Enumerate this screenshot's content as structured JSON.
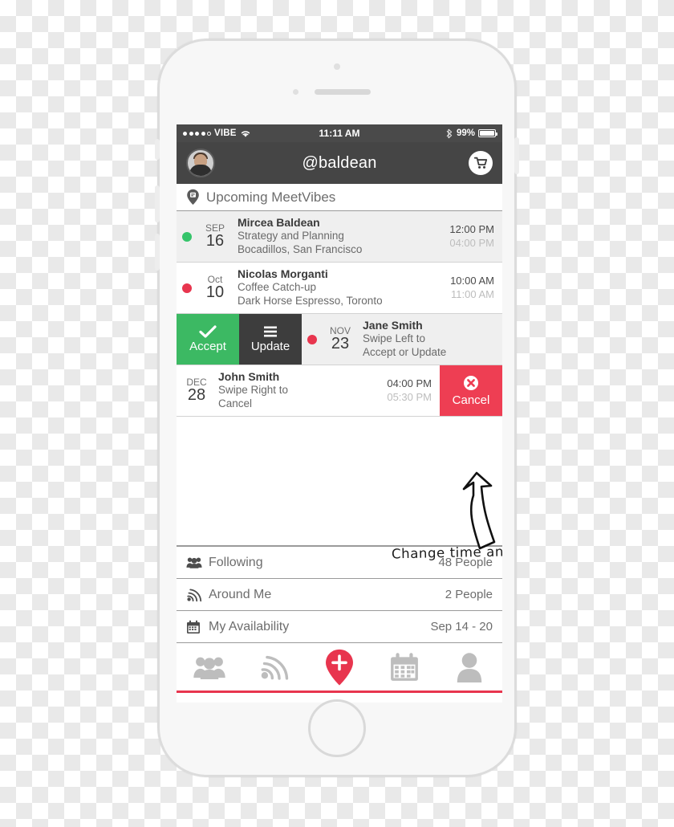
{
  "status_bar": {
    "signal_dots_filled": 4,
    "signal_dots_total": 5,
    "carrier": "VIBE",
    "wifi_icon": "wifi-icon",
    "time": "11:11 AM",
    "bluetooth_icon": "bluetooth-icon",
    "battery_pct": "99%",
    "battery_level": 99
  },
  "navbar": {
    "avatar_icon": "user-avatar",
    "title": "@baldean",
    "cart_icon": "shopping-cart-icon"
  },
  "section_header": {
    "pin_icon": "map-pin-icon",
    "label": "Upcoming MeetVibes"
  },
  "meetings": [
    {
      "dot_color": "#35c46a",
      "month": "SEP",
      "day": "16",
      "name": "Mircea Baldean",
      "subject": "Strategy and Planning",
      "location": "Bocadillos, San Francisco",
      "start": "12:00 PM",
      "end": "04:00 PM",
      "shaded": true
    },
    {
      "dot_color": "#e8354e",
      "month": "Oct",
      "day": "10",
      "name": "Nicolas Morganti",
      "subject": "Coffee Catch-up",
      "location": "Dark Horse Espresso, Toronto",
      "start": "10:00 AM",
      "end": "11:00 AM",
      "shaded": false
    }
  ],
  "swipe_row": {
    "accept_label": "Accept",
    "accept_icon": "check-icon",
    "accept_color": "#3cb963",
    "update_label": "Update",
    "update_icon": "hamburger-menu-icon",
    "update_color": "#3d3d3d",
    "dot_color": "#e8354e",
    "month": "NOV",
    "day": "23",
    "name": "Jane Smith",
    "line1": "Swipe Left to",
    "line2": "Accept or Update"
  },
  "cancel_row": {
    "month": "DEC",
    "day": "28",
    "name": "John Smith",
    "line1": "Swipe Right to",
    "line2": "Cancel",
    "start": "04:00 PM",
    "end": "05:30 PM",
    "cancel_label": "Cancel",
    "cancel_icon": "close-circle-icon",
    "cancel_color": "#ee3e53"
  },
  "stats": [
    {
      "icon": "people-group-icon",
      "label": "Following",
      "value": "48 People"
    },
    {
      "icon": "radar-signal-icon",
      "label": "Around Me",
      "value": "2 People"
    },
    {
      "icon": "calendar-icon",
      "label": "My Availability",
      "value": "Sep 14 - 20"
    }
  ],
  "tabbar": [
    {
      "icon": "people-group-icon",
      "active": false
    },
    {
      "icon": "radar-signal-icon",
      "active": false
    },
    {
      "icon": "add-pin-icon",
      "active": true
    },
    {
      "icon": "calendar-icon",
      "active": false
    },
    {
      "icon": "person-profile-icon",
      "active": false
    }
  ],
  "annotations": {
    "caption": "Change time and location.",
    "arrow_to_list": "curved-arrow-down",
    "arrow_to_update": "curved-arrow-up"
  },
  "theme": {
    "accent_red": "#e8354e",
    "accent_green": "#3cb963",
    "nav_dark": "#454545",
    "status_dark": "#4a4a4a"
  }
}
